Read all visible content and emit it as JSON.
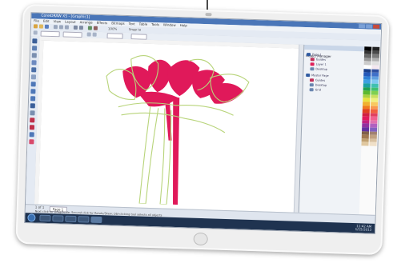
{
  "window": {
    "title": "CorelDRAW X5 - [Graphic1]"
  },
  "menu": [
    "File",
    "Edit",
    "View",
    "Layout",
    "Arrange",
    "Effects",
    "Bitmaps",
    "Text",
    "Table",
    "Tools",
    "Window",
    "Help"
  ],
  "toolbar": {
    "zoom_value": "100%",
    "snap_label": "Snap to"
  },
  "docker": {
    "title": "Object Manager",
    "layers": [
      {
        "label": "Page 1",
        "color": "#2f5aa0"
      },
      {
        "label": "Guides",
        "color": "#c0305a"
      },
      {
        "label": "Layer 1",
        "color": "#e0205a"
      },
      {
        "label": "Desktop",
        "color": "#6a86b0"
      },
      {
        "label": "Master Page",
        "color": "#2f5aa0"
      },
      {
        "label": "Guides",
        "color": "#c0305a"
      },
      {
        "label": "Desktop",
        "color": "#6a86b0"
      },
      {
        "label": "Grid",
        "color": "#6a86b0"
      }
    ]
  },
  "statusbar": {
    "page_tab": "Page 1",
    "page_counter": "1 of 1",
    "status_text": "Next click for Drag/Scale; Second click for Rotate/Skew; Dbl-clicking tool selects all objects"
  },
  "taskbar": {
    "time": "11:42 AM",
    "date": "1/15/2013"
  },
  "artwork": {
    "petal_fill_color": "#e0195a",
    "outline_color": "#b8d47a"
  }
}
